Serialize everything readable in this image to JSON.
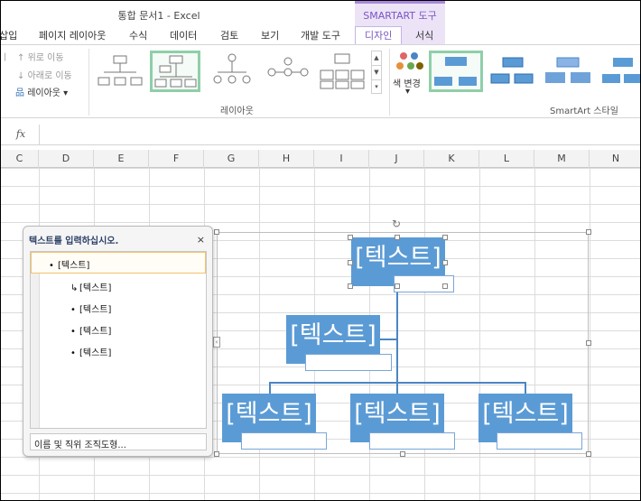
{
  "title_bar": {
    "title": "통합 문서1 - Excel",
    "contextual_tab_group": "SMARTART 도구"
  },
  "tabs": [
    "삽입",
    "페이지 레이아웃",
    "수식",
    "데이터",
    "검토",
    "보기",
    "개발 도구",
    "디자인",
    "서식"
  ],
  "active_tab": "디자인",
  "ribbon": {
    "move_up": "위로 이동",
    "move_down": "아래로 이동",
    "layout_button": "레이아웃",
    "layout_group_label": "레이아웃",
    "change_colors": "색 변경",
    "styles_group_label": "SmartArt 스타일"
  },
  "formula_bar": {
    "fx": "fx",
    "value": ""
  },
  "columns": [
    "C",
    "D",
    "E",
    "F",
    "G",
    "H",
    "I",
    "J",
    "K",
    "L",
    "M",
    "N"
  ],
  "text_pane": {
    "title": "텍스트를 입력하십시오.",
    "close": "×",
    "items": [
      {
        "text": "[텍스트]",
        "bullet": "•"
      },
      {
        "text": "[텍스트]",
        "bullet": "↳"
      },
      {
        "text": "[텍스트]",
        "bullet": "•"
      },
      {
        "text": "[텍스트]",
        "bullet": "•"
      },
      {
        "text": "[텍스트]",
        "bullet": "•"
      }
    ],
    "footer": "이름 및 직위 조직도형..."
  },
  "smartart": {
    "shape_text": "[텍스트]",
    "fill_color": "#5b9bd5",
    "shapes": [
      "[텍스트]",
      "[텍스트]",
      "[텍스트]",
      "[텍스트]",
      "[텍스트]"
    ]
  }
}
